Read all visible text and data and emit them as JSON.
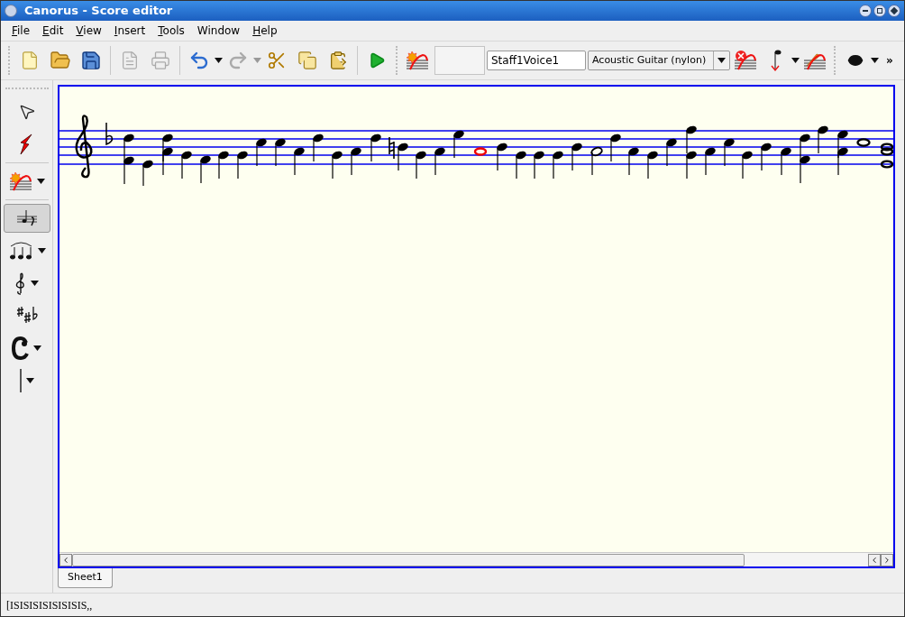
{
  "window": {
    "title": "Canorus - Score editor"
  },
  "menu": [
    {
      "label": "File",
      "mnemonic": true
    },
    {
      "label": "Edit",
      "mnemonic": true
    },
    {
      "label": "View",
      "mnemonic": true
    },
    {
      "label": "Insert",
      "mnemonic": true
    },
    {
      "label": "Tools",
      "mnemonic": true
    },
    {
      "label": "Window",
      "mnemonic": false
    },
    {
      "label": "Help",
      "mnemonic": true
    }
  ],
  "toolbar": {
    "voice_name": "Staff1Voice1",
    "instrument": "Acoustic Guitar (nylon)",
    "overflow": "»"
  },
  "tools": [
    {
      "kind": "select",
      "selected": false,
      "menu": false
    },
    {
      "kind": "eraser",
      "selected": false,
      "menu": false
    },
    {
      "kind": "staff",
      "selected": false,
      "menu": true
    },
    {
      "kind": "voice",
      "selected": true,
      "menu": false
    },
    {
      "kind": "notes",
      "selected": false,
      "menu": true
    },
    {
      "kind": "clef",
      "selected": false,
      "menu": true
    },
    {
      "kind": "accidentals",
      "selected": false,
      "menu": false
    },
    {
      "kind": "time",
      "selected": false,
      "menu": true
    },
    {
      "kind": "barline",
      "selected": false,
      "menu": true
    }
  ],
  "sheets": [
    {
      "label": "Sheet1",
      "selected": true
    }
  ],
  "status_bar": "[ISISISISISISISIS,,"
}
